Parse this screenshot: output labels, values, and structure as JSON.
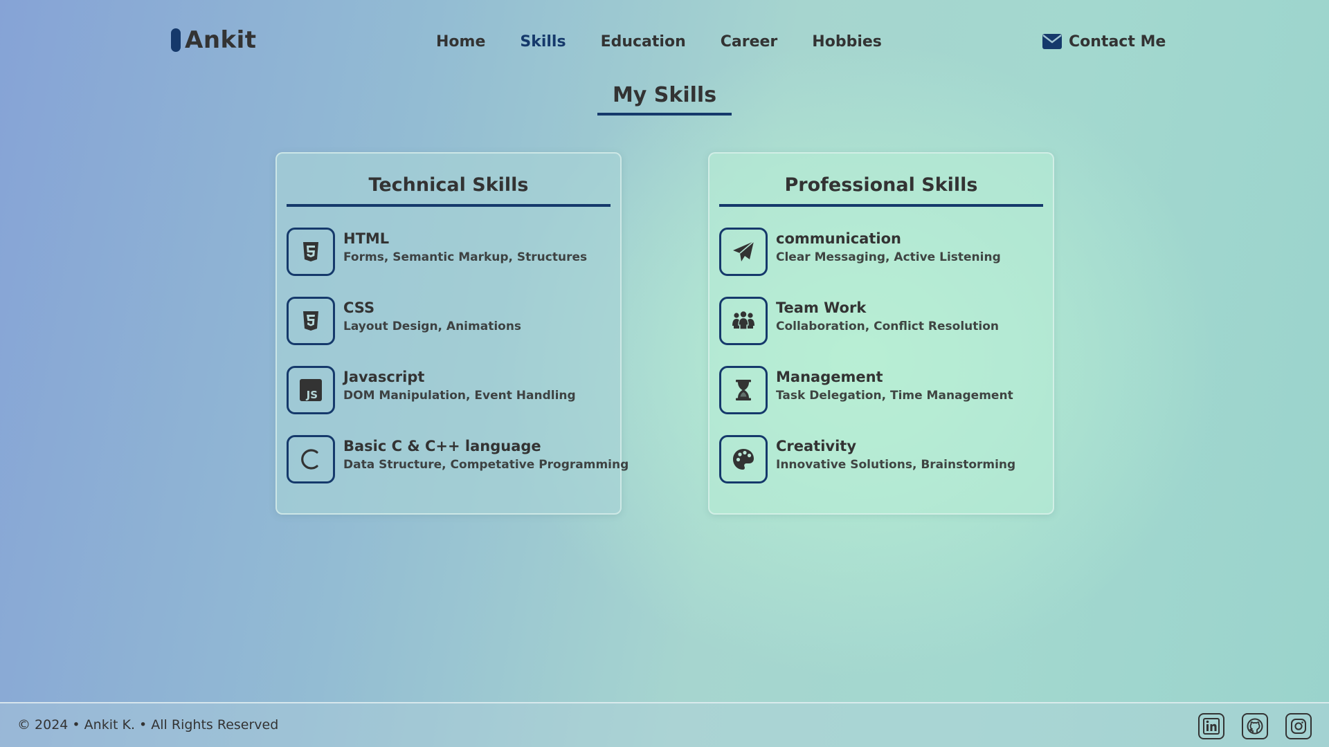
{
  "brand": {
    "name": "Ankit",
    "accent": "#15396b"
  },
  "nav": {
    "items": [
      {
        "label": "Home",
        "active": false
      },
      {
        "label": "Skills",
        "active": true
      },
      {
        "label": "Education",
        "active": false
      },
      {
        "label": "Career",
        "active": false
      },
      {
        "label": "Hobbies",
        "active": false
      }
    ]
  },
  "contact": {
    "label": "Contact Me",
    "icon": "envelope-icon"
  },
  "section": {
    "title": "My Skills"
  },
  "technical": {
    "title": "Technical Skills",
    "items": [
      {
        "name": "HTML",
        "desc": "Forms, Semantic Markup, Structures",
        "icon": "html5-icon"
      },
      {
        "name": "CSS",
        "desc": "Layout Design, Animations",
        "icon": "css3-icon"
      },
      {
        "name": "Javascript",
        "desc": "DOM Manipulation, Event Handling",
        "icon": "javascript-icon"
      },
      {
        "name": "Basic C & C++ language",
        "desc": "Data Structure, Competative Programming",
        "icon": "c-letter-icon"
      }
    ]
  },
  "professional": {
    "title": "Professional Skills",
    "items": [
      {
        "name": "communication",
        "desc": "Clear Messaging, Active Listening",
        "icon": "paper-plane-icon"
      },
      {
        "name": "Team Work",
        "desc": "Collaboration, Conflict Resolution",
        "icon": "people-group-icon"
      },
      {
        "name": "Management",
        "desc": "Task Delegation, Time Management",
        "icon": "hourglass-icon"
      },
      {
        "name": "Creativity",
        "desc": "Innovative Solutions, Brainstorming",
        "icon": "palette-icon"
      }
    ]
  },
  "footer": {
    "text": "© 2024 • Ankit K. • All Rights Reserved",
    "socials": [
      "linkedin-icon",
      "github-icon",
      "instagram-icon"
    ]
  }
}
